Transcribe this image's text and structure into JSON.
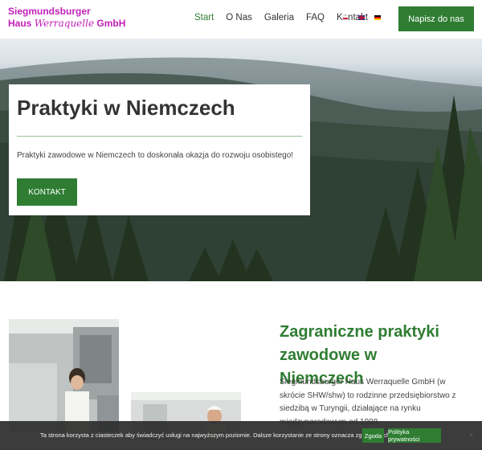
{
  "brand": {
    "line1": "Siegmundsburger",
    "line2a": "Haus",
    "line2b": "Werraquelle",
    "line2c": "GmbH",
    "color": "#c21fb8"
  },
  "nav": {
    "items": [
      "Start",
      "O Nas",
      "Galeria",
      "FAQ",
      "Kontakt"
    ],
    "active": "Start"
  },
  "languages": [
    "pl-flag-icon",
    "en-flag-icon",
    "de-flag-icon"
  ],
  "header_cta": "Napisz do nas",
  "hero": {
    "title": "Praktyki w Niemczech",
    "text": "Praktyki zawodowe w Niemczech to doskonała okazja do rozwoju osobistego!",
    "button": "KONTAKT"
  },
  "section": {
    "title": "Zagraniczne praktyki zawodowe w Niemczech",
    "text": "Siegmundsburger Haus Werraquelle GmbH (w skrócie SHW/shw) to rodzinne przedsiębiorstwo z siedzibą w Turyngii, działające na rynku międzynarodowym od 1998"
  },
  "cookie": {
    "text": "Ta strona korzysta z ciasteczek aby świadczyć usługi na najwyższym poziomie. Dalsze korzystanie ze strony oznacza zgodę na ich wykorzystanie.",
    "accept": "Zgoda",
    "policy": "Polityka prywatności",
    "close": "×"
  },
  "colors": {
    "accent": "#2e7d32",
    "brand": "#c21fb8",
    "cookie_bg": "#2d2d2d"
  }
}
